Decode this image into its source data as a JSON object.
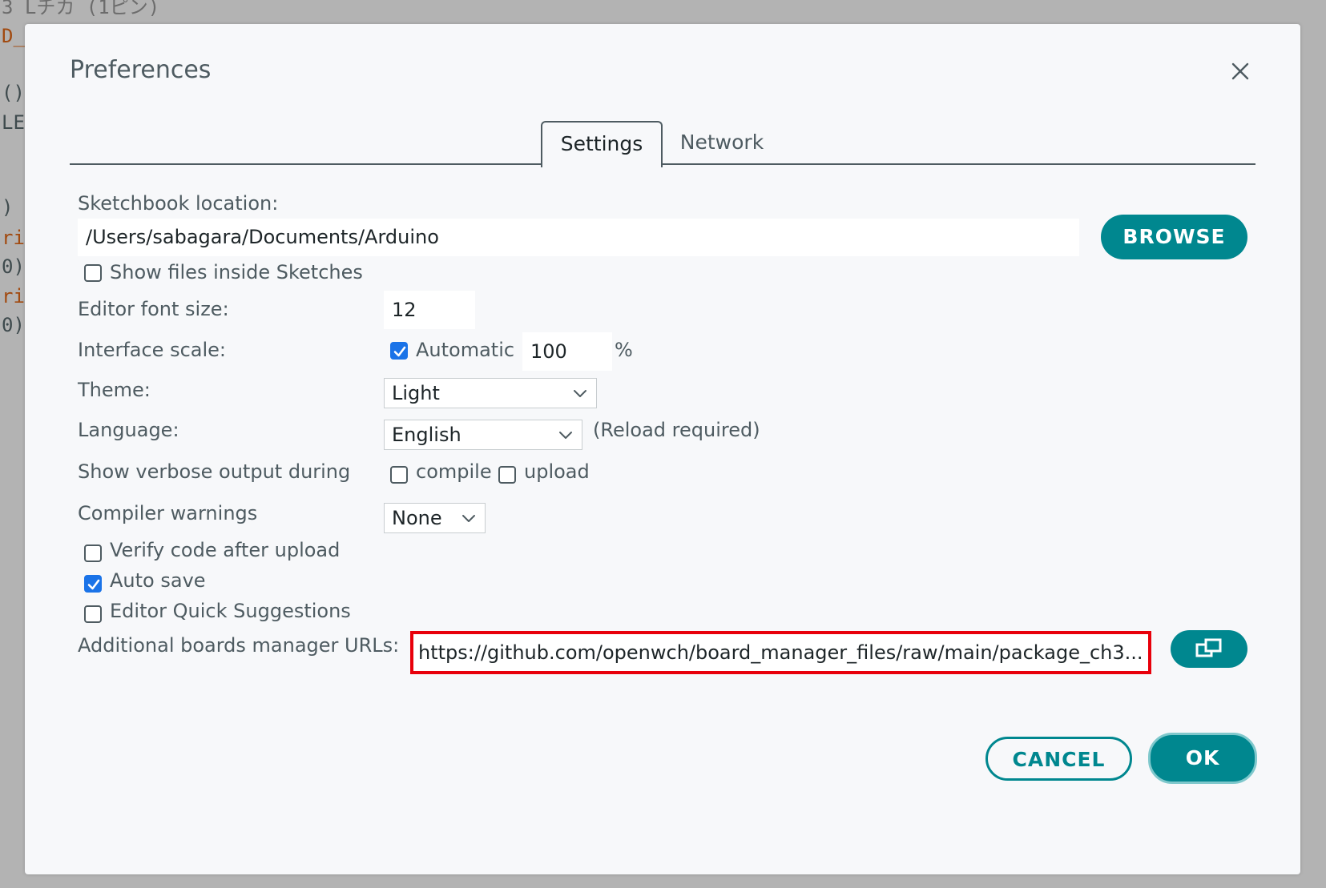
{
  "background_editor": {
    "lines": [
      {
        "text": "3 Lチカ (1ピン)",
        "style": "faint"
      },
      {
        "text": "D_",
        "style": "orange"
      },
      {
        "text": "()",
        "style": "normal"
      },
      {
        "text": "LE",
        "style": "normal"
      },
      {
        "text": ")",
        "style": "normal"
      },
      {
        "text": "ri",
        "style": "orange"
      },
      {
        "text": "0)",
        "style": "normal"
      },
      {
        "text": "ri",
        "style": "orange"
      },
      {
        "text": "0)",
        "style": "normal"
      }
    ]
  },
  "dialog": {
    "title": "Preferences",
    "tabs": [
      {
        "label": "Settings",
        "active": true
      },
      {
        "label": "Network",
        "active": false
      }
    ]
  },
  "settings": {
    "sketchbook": {
      "label": "Sketchbook location:",
      "value": "/Users/sabagara/Documents/Arduino",
      "browse_label": "BROWSE"
    },
    "show_files": {
      "label": "Show files inside Sketches",
      "checked": false
    },
    "editor_font_size": {
      "label": "Editor font size:",
      "value": "12"
    },
    "interface_scale": {
      "label": "Interface scale:",
      "automatic_label": "Automatic",
      "automatic_checked": true,
      "value": "100",
      "unit": "%"
    },
    "theme": {
      "label": "Theme:",
      "value": "Light"
    },
    "language": {
      "label": "Language:",
      "value": "English",
      "note": "(Reload required)"
    },
    "verbose": {
      "label": "Show verbose output during",
      "compile_label": "compile",
      "compile_checked": false,
      "upload_label": "upload",
      "upload_checked": false
    },
    "compiler_warnings": {
      "label": "Compiler warnings",
      "value": "None"
    },
    "verify_code": {
      "label": "Verify code after upload",
      "checked": false
    },
    "auto_save": {
      "label": "Auto save",
      "checked": true
    },
    "quick_suggestions": {
      "label": "Editor Quick Suggestions",
      "checked": false
    },
    "boards_urls": {
      "label": "Additional boards manager URLs:",
      "value": "https://github.com/openwch/board_manager_files/raw/main/package_ch3..."
    }
  },
  "footer": {
    "cancel_label": "CANCEL",
    "ok_label": "OK"
  },
  "colors": {
    "accent": "#00878f",
    "highlight_border": "#e8000b",
    "checkbox_checked": "#1a73e8",
    "text": "#4e5b61"
  }
}
